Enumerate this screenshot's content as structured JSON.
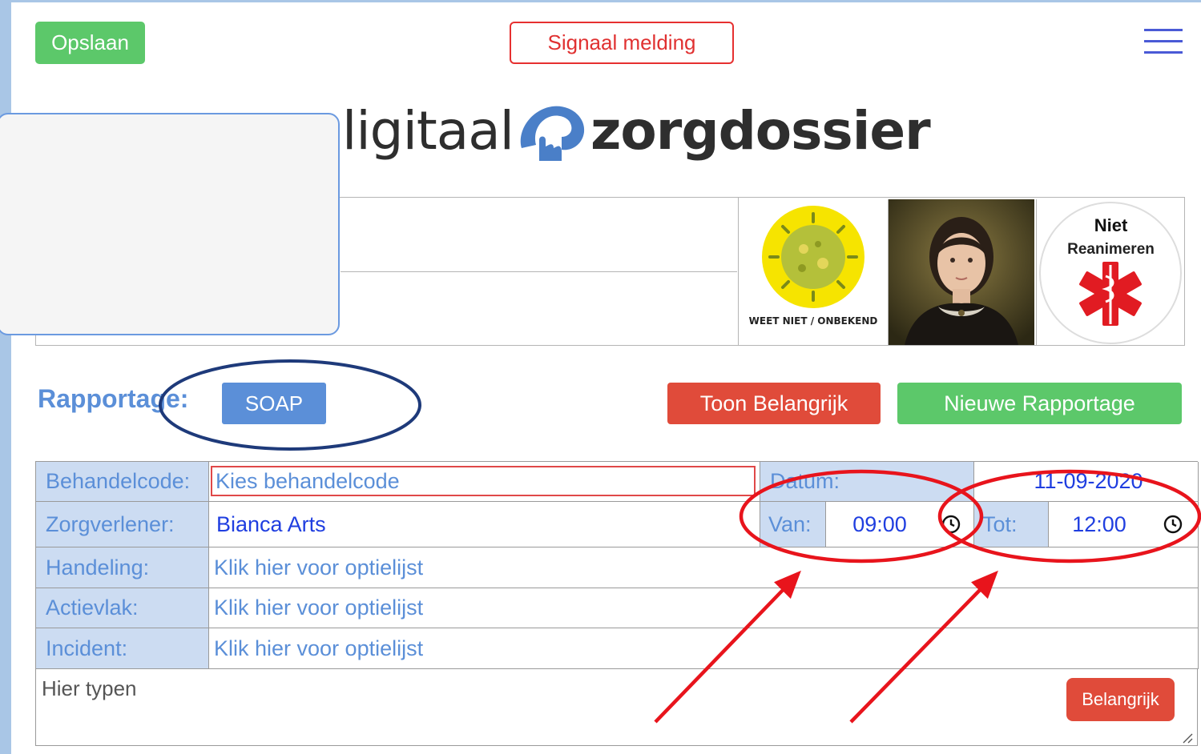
{
  "toolbar": {
    "save_label": "Opslaan",
    "signal_label": "Signaal melding"
  },
  "logo": {
    "part1": "ligitaal",
    "part2": "zorgdossier"
  },
  "badges": {
    "covid_caption": "WEET NIET / ONBEKEND",
    "dnr_line1": "Niet",
    "dnr_line2": "Reanimeren"
  },
  "report": {
    "label": "Rapportage:",
    "soap_label": "SOAP",
    "show_important_label": "Toon Belangrijk",
    "new_report_label": "Nieuwe Rapportage"
  },
  "form": {
    "treatment_label": "Behandelcode:",
    "treatment_placeholder": "Kies behandelcode",
    "date_label": "Datum:",
    "date_value": "11-09-2020",
    "provider_label": "Zorgverlener:",
    "provider_value": "Bianca Arts",
    "from_label": "Van:",
    "from_value": "09:00",
    "to_label": "Tot:",
    "to_value": "12:00",
    "action_label": "Handeling:",
    "action_value": "Klik hier voor optielijst",
    "area_label": "Actievlak:",
    "area_value": "Klik hier voor optielijst",
    "incident_label": "Incident:",
    "incident_value": "Klik hier voor optielijst",
    "note_placeholder": "Hier typen",
    "important_label": "Belangrijk"
  },
  "colors": {
    "green": "#5cc86a",
    "red": "#e04b3a",
    "blue": "#5b8fd8",
    "label_bg": "#ccdcf2",
    "annotation_red": "#e8141c",
    "annotation_navy": "#1e3a7a"
  }
}
